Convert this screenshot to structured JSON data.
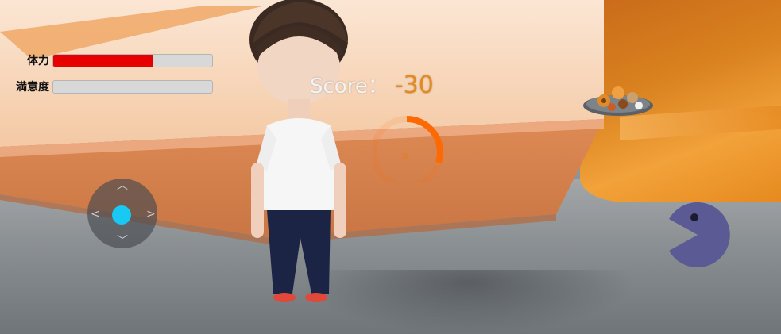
{
  "hud": {
    "stamina_label": "体力",
    "stamina_level": 0.63,
    "satisfaction_label": "満意度",
    "satisfaction_level": 0.0,
    "score_label": "Score：",
    "score_value": "-30"
  },
  "controls": {
    "joystick_icon": "dpad-joystick-icon",
    "action_icon": "pacman-icon"
  },
  "colors": {
    "stamina_fill": "#e60000",
    "score_value": "#e38a22",
    "joystick_knob": "#17c9f3",
    "action_button": "#5b5a94",
    "timer_ring": "#ff6a00"
  },
  "timer": {
    "fill": 0.3
  }
}
